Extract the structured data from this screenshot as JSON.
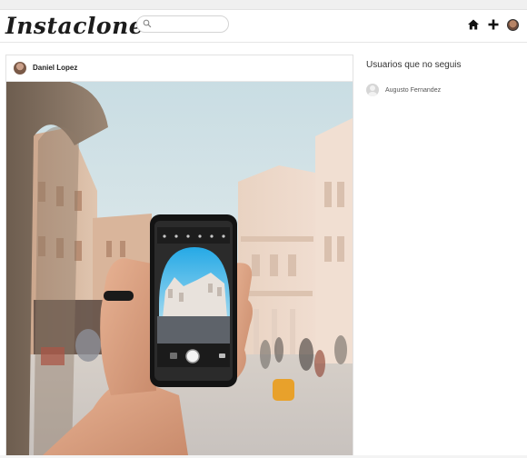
{
  "header": {
    "logo": "Instaclone",
    "search": {
      "placeholder": "",
      "value": ""
    },
    "icons": [
      "home-icon",
      "plus-icon",
      "profile-avatar"
    ]
  },
  "post": {
    "username": "Daniel Lopez",
    "image": "hand-holding-phone-photo"
  },
  "sidebar": {
    "title": "Usuarios que no seguis",
    "suggestions": [
      {
        "name": "Augusto Fernandez"
      }
    ]
  },
  "colors": {
    "text": "#222222",
    "border": "#e2e2e2",
    "logo": "#1c1c1c"
  }
}
